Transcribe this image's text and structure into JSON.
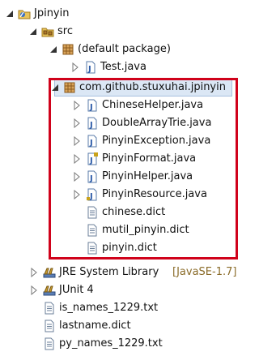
{
  "tree": {
    "project": {
      "label": "Jpinyin"
    },
    "src": {
      "label": "src"
    },
    "default_package": {
      "label": "(default package)"
    },
    "test_java": {
      "label": "Test.java"
    },
    "package": {
      "label": "com.github.stuxuhai.jpinyin"
    },
    "package_files": [
      {
        "label": "ChineseHelper.java"
      },
      {
        "label": "DoubleArrayTrie.java"
      },
      {
        "label": "PinyinException.java"
      },
      {
        "label": "PinyinFormat.java"
      },
      {
        "label": "PinyinHelper.java"
      },
      {
        "label": "PinyinResource.java"
      },
      {
        "label": "chinese.dict"
      },
      {
        "label": "mutil_pinyin.dict"
      },
      {
        "label": "pinyin.dict"
      }
    ],
    "jre": {
      "label": "JRE System Library",
      "decoration": "[JavaSE-1.7]"
    },
    "junit": {
      "label": "JUnit 4"
    },
    "root_files": [
      {
        "label": "is_names_1229.txt"
      },
      {
        "label": "lastname.dict"
      },
      {
        "label": "py_names_1229.txt"
      }
    ]
  },
  "colors": {
    "highlight_border": "#d0021b",
    "selection": "#dbe7f5",
    "decoration": "#8a6b28"
  }
}
